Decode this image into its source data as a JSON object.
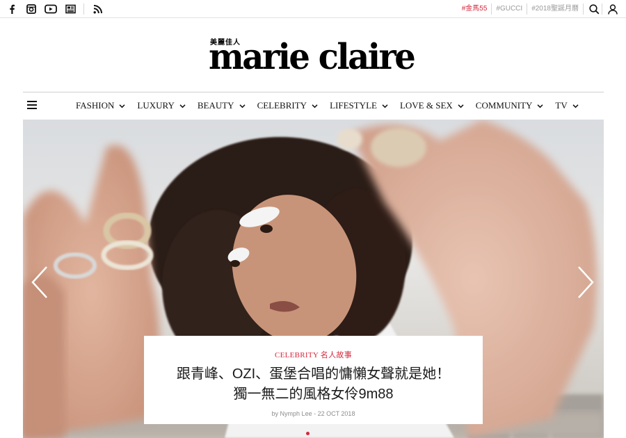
{
  "topbar": {
    "social": [
      {
        "icon": "facebook-icon",
        "glyph": "f"
      },
      {
        "icon": "instagram-icon"
      },
      {
        "icon": "youtube-icon"
      },
      {
        "icon": "news-icon"
      },
      {
        "icon": "rss-icon"
      }
    ],
    "tags": [
      {
        "label": "#金馬55",
        "color": "#d6273b"
      },
      {
        "label": "#GUCCI",
        "color": "#999999"
      },
      {
        "label": "#2018聖誕月曆",
        "color": "#999999"
      }
    ]
  },
  "logo": {
    "chinese": "美麗佳人",
    "main": "marie claire"
  },
  "nav": {
    "items": [
      "FASHION",
      "LUXURY",
      "BEAUTY",
      "CELEBRITY",
      "LIFESTYLE",
      "LOVE & SEX",
      "COMMUNITY",
      "TV"
    ]
  },
  "hero": {
    "category": "CELEBRITY 名人故事",
    "title_line1": "跟青峰、OZI、蛋堡合唱的慵懶女聲就是她！",
    "title_line2": "獨一無二的風格女伶9m88",
    "byline": "by Nymph Lee - 22 OCT 2018",
    "accent_color": "#d6273b"
  }
}
